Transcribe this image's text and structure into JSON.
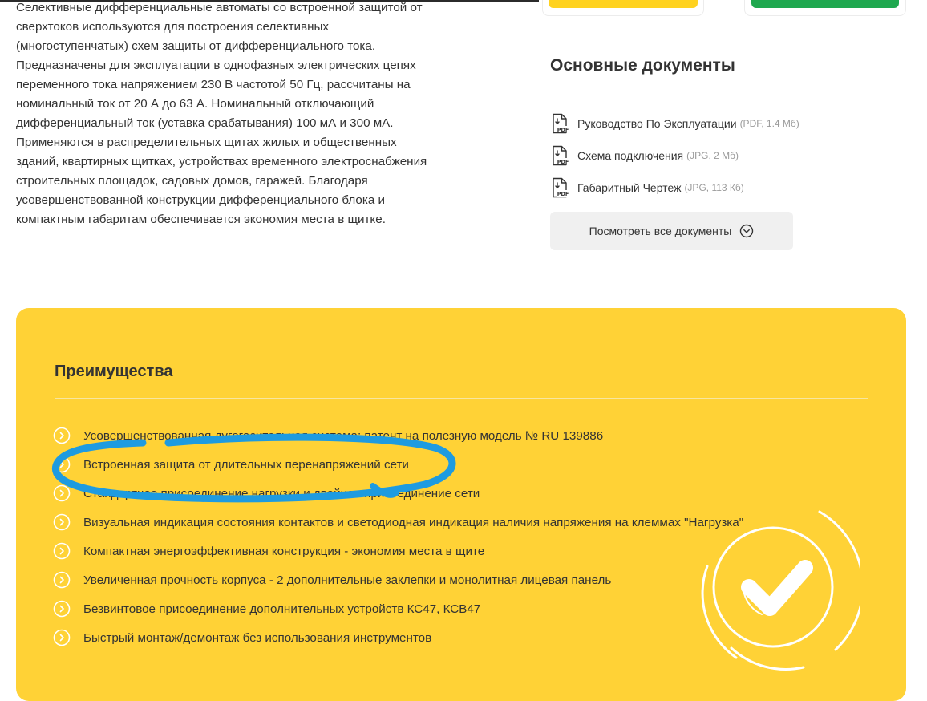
{
  "description": {
    "lines": [
      "Селективные дифференциальные автоматы со встроенной защитой от",
      "сверхтоков используются для построения селективных",
      "(многоступенчатых) схем защиты от дифференциального тока.",
      "Предназначены для эксплуатации в однофазных электрических цепях",
      "переменного тока напряжением 230 В частотой 50 Гц, рассчитаны на",
      "номинальный ток от 20 А до 63 А. Номинальный отключающий",
      "дифференциальный ток (уставка срабатывания) 100 мА и 300 мА.",
      "Применяются в распределительных щитах жилых и общественных",
      "зданий, квартирных щитках, устройствах временного электроснабжения",
      "строительных площадок, садовых домов, гаражей. Благодаря",
      "усовершенствованной конструкции дифференциального блока и",
      "компактным габаритам обеспечивается экономия места в щитке."
    ]
  },
  "documents": {
    "title": "Основные документы",
    "items": [
      {
        "name": "Руководство По Эксплуатации",
        "meta": "(PDF, 1.4 Мб)",
        "icon": "pdf-file-icon"
      },
      {
        "name": "Схема подключения",
        "meta": "(JPG, 2 Мб)",
        "icon": "pdf-file-icon"
      },
      {
        "name": "Габаритный Чертеж",
        "meta": "(JPG, 113 Кб)",
        "icon": "pdf-file-icon"
      }
    ],
    "view_all_label": "Посмотреть все документы",
    "file_badge": "PDF"
  },
  "advantages": {
    "title": "Преимущества",
    "items": [
      "Усовершенствованная дугогасительная система: патент на полезную модель № RU 139886",
      "Встроенная защита от длительных перенапряжений сети",
      "Стандартное присоединение нагрузки и двойное присоединение сети",
      "Визуальная индикация состояния контактов и светодиодная индикация наличия напряжения на клеммах \"Нагрузка\"",
      "Компактная энергоэффективная конструкция - экономия места в щите",
      "Увеличенная прочность корпуса - 2 дополнительные заклепки и монолитная лицевая панель",
      "Безвинтовое присоединение дополнительных устройств КС47, КСВ47",
      "Быстрый монтаж/демонтаж без использования инструментов"
    ]
  },
  "colors": {
    "panel_yellow": "#ffd236",
    "button_yellow": "#ffd21f",
    "button_green": "#1fa84f",
    "highlight_blue": "#1e9be0",
    "text": "#333333"
  }
}
